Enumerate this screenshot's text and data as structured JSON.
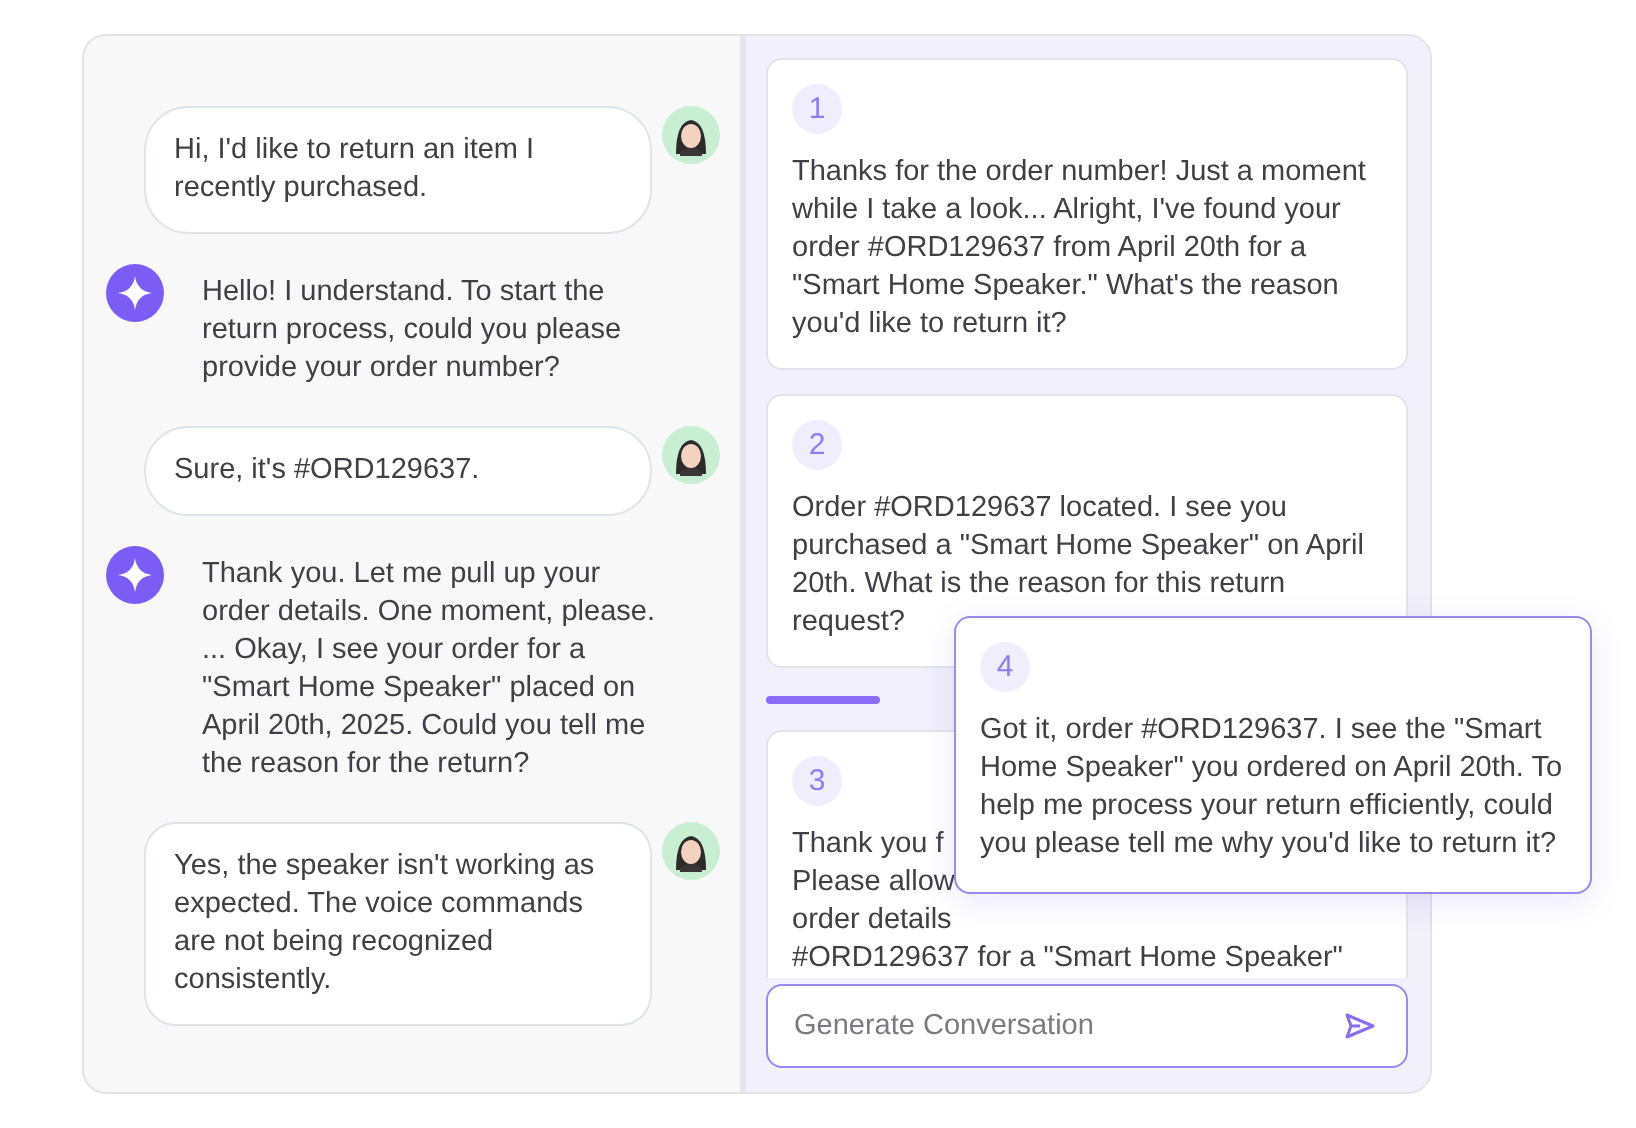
{
  "messages": [
    {
      "kind": "user",
      "text": "Hi, I'd like to return an item I recently purchased."
    },
    {
      "kind": "bot",
      "text": "Hello! I understand. To start the return process, could you please provide your order number?"
    },
    {
      "kind": "user",
      "text": "Sure, it's #ORD129637."
    },
    {
      "kind": "bot",
      "text": "Thank you. Let me pull up your order details. One moment, please. ... Okay, I see your order for a \"Smart Home Speaker\" placed on April 20th, 2025. Could you tell me the reason for the return?"
    },
    {
      "kind": "user",
      "text": " Yes, the speaker isn't working as expected. The voice commands are not being recognized consistently."
    }
  ],
  "responses": [
    {
      "kind": "full",
      "number": "1",
      "text": "Thanks for the order number! Just a moment while I take a look... Alright, I've found your order #ORD129637 from April 20th for a \"Smart Home Speaker.\" What's the reason you'd like to return it?"
    },
    {
      "kind": "full",
      "number": "2",
      "text": "Order #ORD129637 located. I see you purchased a \"Smart Home Speaker\" on April 20th. What is the reason for this return request?"
    },
    {
      "kind": "partial",
      "number": "3",
      "lines": [
        "Thank you f",
        "Please allow",
        "order details",
        "#ORD129637 for a \"Smart Home Speaker\""
      ]
    }
  ],
  "popup": {
    "number": "4",
    "text": "Got it, order #ORD129637. I see the \"Smart Home Speaker\" you ordered on April 20th. To help me process your return efficiently, could you please tell me why you'd like to return it?"
  },
  "input": {
    "placeholder": "Generate Conversation"
  }
}
